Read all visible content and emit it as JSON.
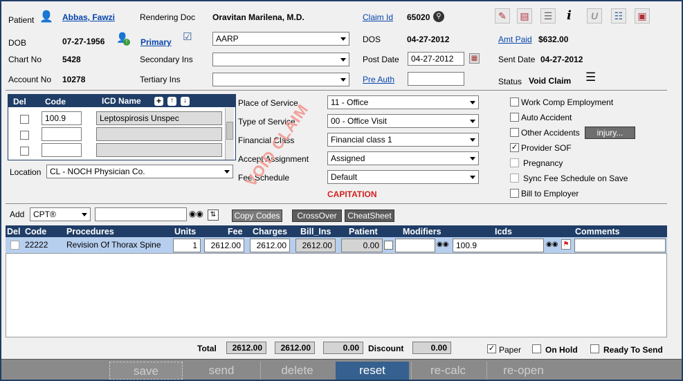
{
  "header": {
    "patient_label": "Patient",
    "patient_name": "Abbas, Fawzi",
    "rendering_doc_label": "Rendering Doc",
    "rendering_doc": "Oravitan Marilena, M.D.",
    "claim_id_label": "Claim Id",
    "claim_id": "65020",
    "dob_label": "DOB",
    "dob": "07-27-1956",
    "primary_label": "Primary",
    "primary_ins": "AARP",
    "dos_label": "DOS",
    "dos": "04-27-2012",
    "amt_paid_label": "Amt Paid",
    "amt_paid": "$632.00",
    "chart_label": "Chart No",
    "chart_no": "5428",
    "secondary_label": "Secondary Ins",
    "secondary_ins": "",
    "post_date_label": "Post Date",
    "post_date": "04-27-2012",
    "sent_date_label": "Sent Date",
    "sent_date": "04-27-2012",
    "account_label": "Account No",
    "account_no": "10278",
    "tertiary_label": "Tertiary Ins",
    "tertiary_ins": "",
    "pre_auth_label": "Pre Auth",
    "pre_auth": "",
    "status_label": "Status",
    "status": "Void Claim"
  },
  "icd": {
    "del_label": "Del",
    "code_label": "Code",
    "name_label": "ICD Name",
    "rows": [
      {
        "code": "100.9",
        "name": "Leptospirosis Unspec"
      },
      {
        "code": "",
        "name": ""
      },
      {
        "code": "",
        "name": ""
      }
    ]
  },
  "location": {
    "label": "Location",
    "value": "CL - NOCH Physician Co."
  },
  "service": {
    "pos_label": "Place of Service",
    "pos": "11 - Office",
    "tos_label": "Type of Service",
    "tos": "00 - Office Visit",
    "fin_label": "Financial Class",
    "fin": "Financial class 1",
    "accept_label": "Accept Assignment",
    "accept": "Assigned",
    "fee_label": "Fee Schedule",
    "fee": "Default",
    "capitation": "CAPITATION",
    "watermark": "VOID CLAIM"
  },
  "flags": {
    "work_comp": "Work Comp Employment",
    "auto_accident": "Auto Accident",
    "other_accidents": "Other Accidents",
    "injury_btn": "injury...",
    "provider_sof": "Provider SOF",
    "pregnancy": "Pregnancy",
    "sync_fee": "Sync Fee Schedule on Save",
    "bill_employer": "Bill to Employer"
  },
  "add_bar": {
    "add_label": "Add",
    "type": "CPT®",
    "search": "",
    "copy_codes": "Copy Codes",
    "crossover": "CrossOver",
    "cheatsheet": "CheatSheet"
  },
  "procedures": {
    "columns": [
      "Del",
      "Code",
      "Procedures",
      "Units",
      "Fee",
      "Charges",
      "Bill_Ins",
      "Patient",
      "Modifiers",
      "Icds",
      "Comments"
    ],
    "rows": [
      {
        "code": "22222",
        "procedure": "Revision Of Thorax Spine",
        "units": "1",
        "fee": "2612.00",
        "charges": "2612.00",
        "bill_ins": "2612.00",
        "patient": "0.00",
        "modifiers": "",
        "icds": "100.9",
        "comments": ""
      }
    ]
  },
  "totals": {
    "total_label": "Total",
    "total_charges": "2612.00",
    "total_bill_ins": "2612.00",
    "total_patient": "0.00",
    "discount_label": "Discount",
    "discount": "0.00",
    "paper": "Paper",
    "on_hold": "On Hold",
    "ready": "Ready To Send"
  },
  "actions": {
    "save": "save",
    "send": "send",
    "delete": "delete",
    "reset": "reset",
    "recalc": "re-calc",
    "reopen": "re-open"
  }
}
